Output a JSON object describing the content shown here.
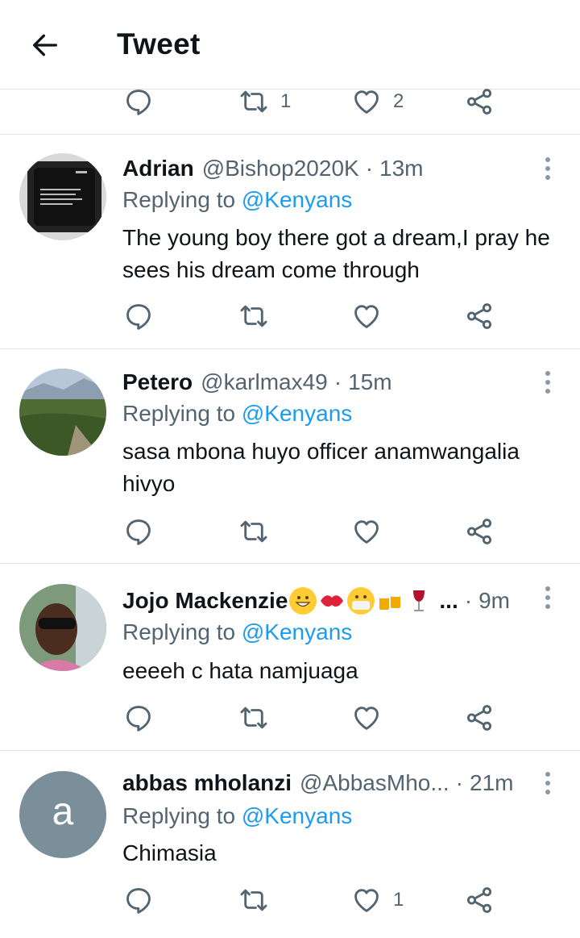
{
  "header": {
    "back_icon": "arrow-left-icon",
    "title": "Tweet"
  },
  "top_actions": {
    "retweet_count": "1",
    "like_count": "2"
  },
  "replies": [
    {
      "name": "Adrian",
      "handle": "@Bishop2020K",
      "separator": "·",
      "time": "13m",
      "replying_prefix": "Replying to",
      "mention": "@Kenyans",
      "text": "The young boy there got a dream,I pray he sees his dream come through",
      "retweet_count": "",
      "like_count": ""
    },
    {
      "name": "Petero",
      "handle": "@karlmax49",
      "separator": "·",
      "time": "15m",
      "replying_prefix": "Replying to",
      "mention": "@Kenyans",
      "text": "sasa mbona huyo officer anamwangalia hivyo",
      "retweet_count": "",
      "like_count": ""
    },
    {
      "name": "Jojo Mackenzie",
      "name_emojis": [
        "grinning-face",
        "kiss-mark",
        "face-with-mask",
        "beer-mugs",
        "wine-glass"
      ],
      "name_truncation": "...",
      "separator": "·",
      "time": "9m",
      "replying_prefix": "Replying to",
      "mention": "@Kenyans",
      "text": "eeeeh c hata namjuaga",
      "retweet_count": "",
      "like_count": ""
    },
    {
      "name": "abbas mholanzi",
      "handle": "@AbbasMho...",
      "separator": "·",
      "time": "21m",
      "avatar_letter": "a",
      "replying_prefix": "Replying to",
      "mention": "@Kenyans",
      "text": "Chimasia",
      "retweet_count": "",
      "like_count": "1"
    }
  ],
  "colors": {
    "text_primary": "#0f1419",
    "text_secondary": "#536471",
    "accent": "#1d9bf0",
    "divider": "#e1e5e8",
    "icon": "#536471",
    "letter_avatar_bg": "#7a8f9a"
  }
}
